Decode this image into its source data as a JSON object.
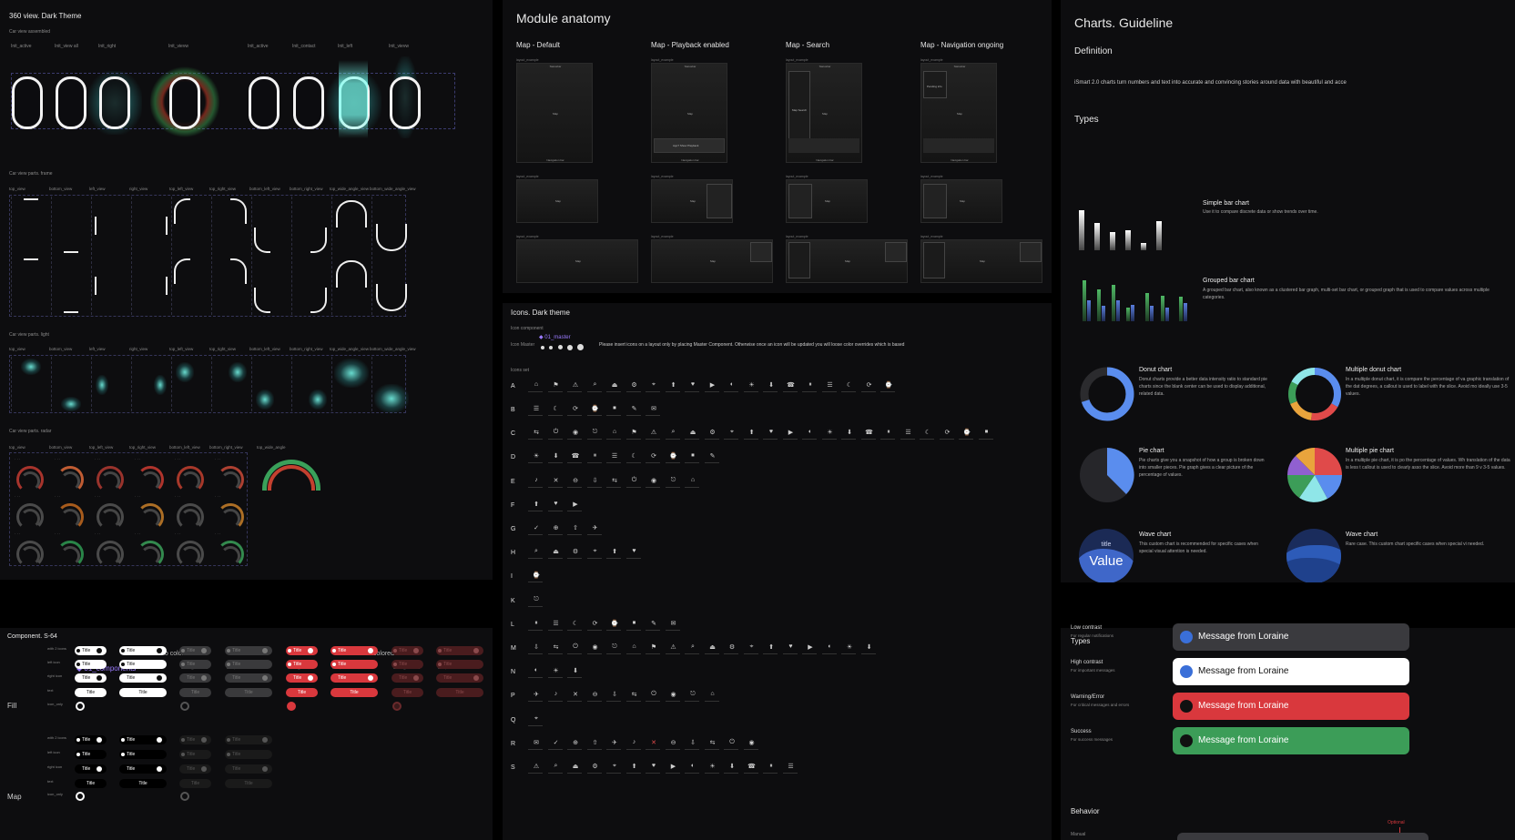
{
  "p360": {
    "title": "360 view. Dark Theme",
    "sub1": "Car view assembled",
    "labels1": [
      "Init_active",
      "Init_view all",
      "Init_right",
      "Init_vievw",
      "Init_active",
      "Init_contact",
      "Init_left",
      "Init_vievw"
    ],
    "sub2": "Car view parts. frame",
    "labels2": [
      "top_view",
      "bottom_view",
      "left_view",
      "right_view",
      "top_left_view",
      "top_right_view",
      "bottom_left_view",
      "bottom_right_view",
      "top_wide_angle_view",
      "bottom_wide_angle_view"
    ],
    "sub3": "Car view parts. light",
    "sub4": "Car view parts. radar",
    "labels4": [
      "top_view",
      "bottom_view",
      "top_left_view",
      "top_right_view",
      "bottom_left_view",
      "bottom_right_view",
      "top_wide_angle"
    ]
  },
  "anatomy": {
    "title": "Module anatomy",
    "cols": [
      "Map - Default",
      "Map - Playback enabled",
      "Map - Search",
      "Map - Navigation ongoing"
    ],
    "layout": "layout_example",
    "map": "Map",
    "nav": "Navigation bar",
    "status": "Statusbar",
    "search": "Map Search",
    "panel": "App? Show Playback",
    "pending": "Pending info"
  },
  "icons": {
    "title": "Icons. Dark theme",
    "comp": "Icon component",
    "master_lbl": "Icon Master",
    "master_name": "01_master",
    "note": "Please insert icons on a layout only by placing Master Component. Otherwise once an icon will be updated you will loose color overrides which is based",
    "set": "Icons set",
    "letters": [
      "A",
      "B",
      "C",
      "D",
      "E",
      "F",
      "G",
      "H",
      "I",
      "K",
      "L",
      "M",
      "N",
      "P",
      "Q",
      "R",
      "S"
    ],
    "counts": [
      19,
      7,
      24,
      10,
      9,
      3,
      4,
      6,
      1,
      1,
      8,
      18,
      3,
      10,
      1,
      12,
      14
    ]
  },
  "charts": {
    "title": "Charts. Guideline",
    "def_h": "Definition",
    "def": "iSmart 2.0 charts turn numbers and text into accurate and convincing stories around data with beautiful and acce",
    "types_h": "Types",
    "items": [
      {
        "name": "Simple bar chart",
        "desc": "Use it to compare discrete data or show trends over time."
      },
      {
        "name": "Grouped bar chart",
        "desc": "A grouped bar chart, also known as a clustered bar graph, multi-set bar chart, or grouped graph that is used to compare values across multiple categories."
      },
      {
        "name": "Donut chart",
        "desc": "Donut charts provide a better data intensity ratio to standard pie charts since the blank center can be used to display additional, related data."
      },
      {
        "name": "Multiple donut chart",
        "desc": "In a multiple donut chart, it is compare the percentage of va graphic translation of the dat degrees, a callout is used to label with the slice. Avoid mo ideally use 3-5 values."
      },
      {
        "name": "Pie chart",
        "desc": "Pie charts give you a snapshot of how a group is broken down into smaller pieces. Pie graph gives a clear picture of the percentage of values."
      },
      {
        "name": "Multiple pie chart",
        "desc": "In a multiple pie chart, it is po the percentage of values. Wh translation of the data is less t callout is used to clearly asso the slice. Avoid more than 9 v 3-5 values."
      },
      {
        "name": "Wave chart",
        "desc": "This custom chart is recommended for specific cases when special visual attention is needed."
      },
      {
        "name": "Wave chart",
        "desc": "Rare case. This custom chart specific cases when special vi needed."
      }
    ],
    "wave_title": "title",
    "wave_value": "Value"
  },
  "comp": {
    "title": "Component. S-64",
    "nocolor": "no color",
    "colored": "colored",
    "tag": "01_components",
    "heads": [
      "static, enabled",
      "static, hover",
      "stretchy, disabled",
      "fixed, disabled",
      "stretchy, enabled",
      "fixed, enabled",
      "stretchy, disabled",
      "fixed, disabled"
    ],
    "fill": "Fill",
    "map": "Map",
    "rows": [
      "with 2 icons",
      "left icon",
      "right icon",
      "text",
      "icon_only"
    ],
    "pill": "Title"
  },
  "toasts": {
    "title": "Types",
    "behavior": "Behavior",
    "optional": "Optional",
    "items": [
      {
        "name": "Low contrast",
        "desc": "For regular notifications",
        "msg": "Message from Loraine"
      },
      {
        "name": "High contrast",
        "desc": "For important messages",
        "msg": "Message from Loraine"
      },
      {
        "name": "Warning/Error",
        "desc": "For critical messages and errors",
        "msg": "Message from Loraine"
      },
      {
        "name": "Success",
        "desc": "For success messages",
        "msg": "Message from Loraine"
      }
    ],
    "manual": "Manual"
  },
  "colors": {
    "accent": "#5a8dee",
    "teal": "#7ff3ea",
    "red": "#d9383d",
    "green": "#3c9d58"
  }
}
